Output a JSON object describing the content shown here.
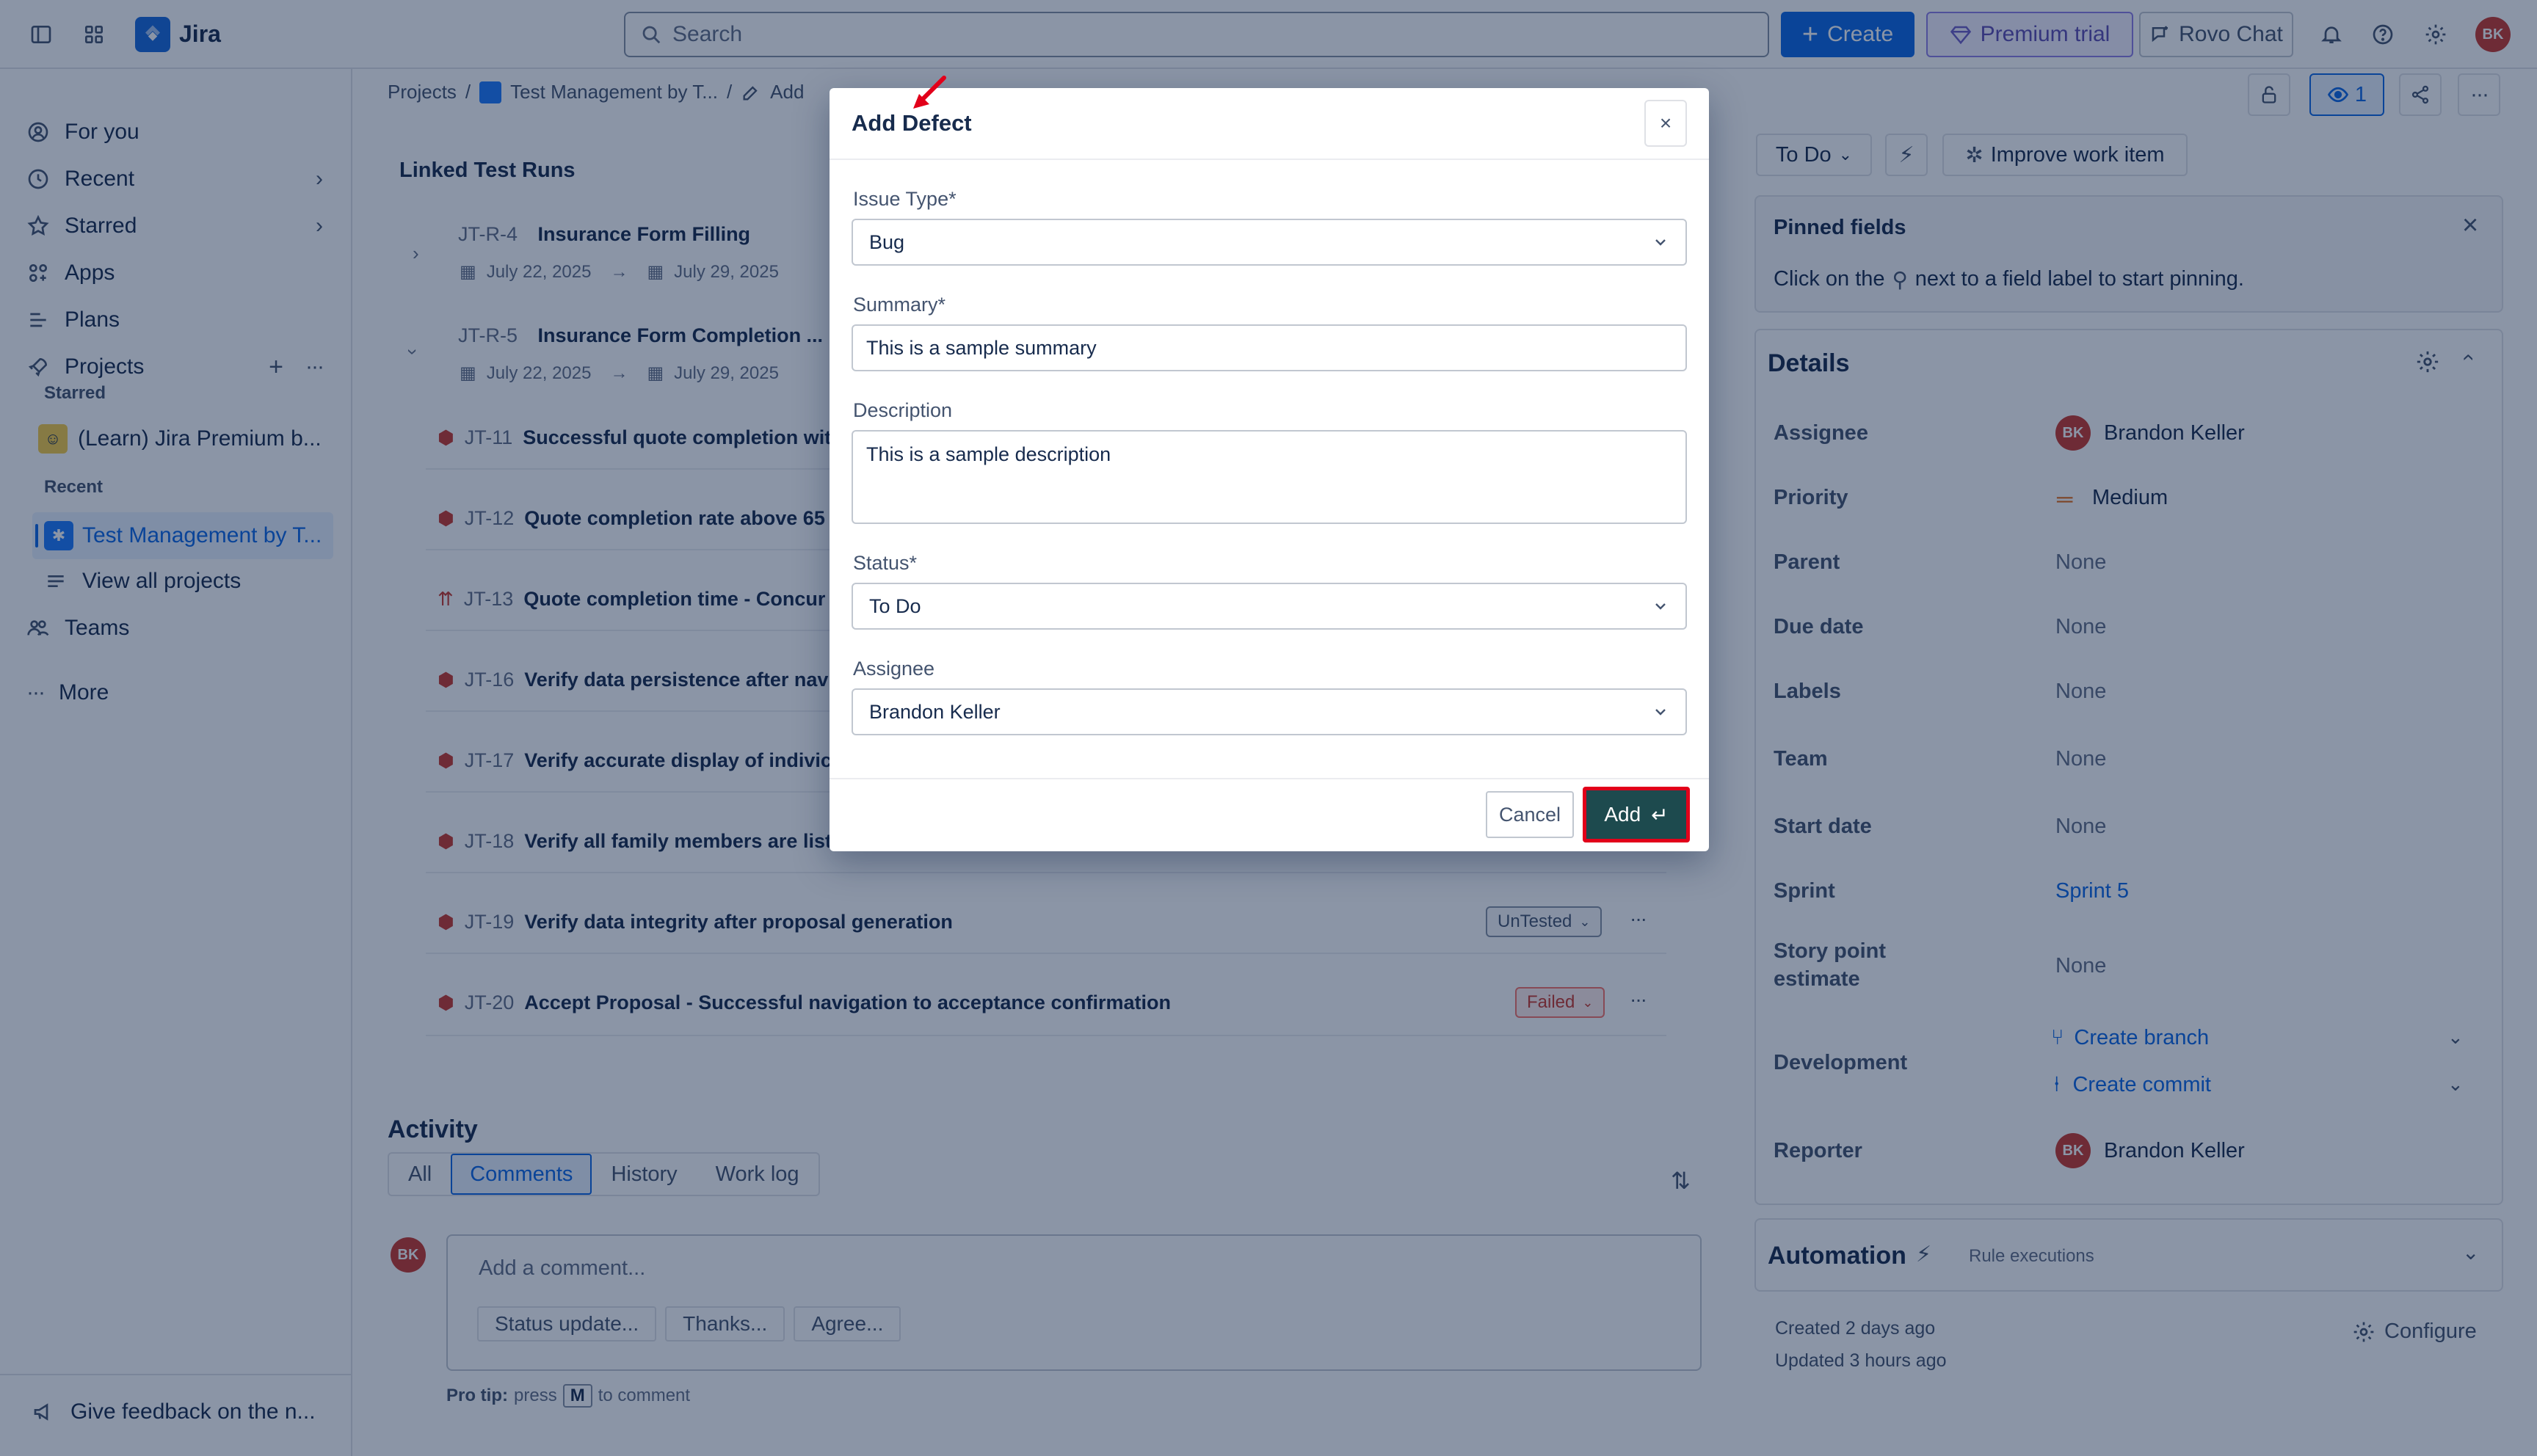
{
  "topbar": {
    "app_name": "Jira",
    "search_placeholder": "Search",
    "create_label": "Create",
    "premium_label": "Premium trial",
    "rovo_label": "Rovo Chat",
    "avatar_initials": "BK"
  },
  "sidebar": {
    "items": {
      "for_you": "For you",
      "recent": "Recent",
      "starred": "Starred",
      "apps": "Apps",
      "plans": "Plans",
      "projects": "Projects",
      "view_all": "View all projects",
      "teams": "Teams",
      "more": "More"
    },
    "starred_heading": "Starred",
    "starred_project": "(Learn) Jira Premium b...",
    "recent_heading": "Recent",
    "recent_project": "Test Management by T...",
    "feedback": "Give feedback on the n..."
  },
  "breadcrumb": {
    "projects": "Projects",
    "sep": "/",
    "project": "Test Management by T...",
    "sep2": "/",
    "partial": "Add"
  },
  "linked": {
    "title": "Linked Test Runs",
    "runs": [
      {
        "key": "JT-R-4",
        "name": "Insurance Form Filling",
        "start": "July 22, 2025",
        "end": "July 29, 2025"
      },
      {
        "key": "JT-R-5",
        "name": "Insurance Form Completion ...",
        "start": "July 22, 2025",
        "end": "July 29, 2025"
      }
    ],
    "cases": [
      {
        "key": "JT-11",
        "name": "Successful quote completion wit"
      },
      {
        "key": "JT-12",
        "name": "Quote completion rate above 65"
      },
      {
        "key": "JT-13",
        "name": "Quote completion time - Concur"
      },
      {
        "key": "JT-16",
        "name": "Verify data persistence after nav"
      },
      {
        "key": "JT-17",
        "name": "Verify accurate display of indivic"
      },
      {
        "key": "JT-18",
        "name": "Verify all family members are list"
      },
      {
        "key": "JT-19",
        "name": "Verify data integrity after proposal generation",
        "status": "UnTested"
      },
      {
        "key": "JT-20",
        "name": "Accept Proposal - Successful navigation to acceptance confirmation",
        "status": "Failed"
      }
    ]
  },
  "activity": {
    "title": "Activity",
    "tabs": [
      "All",
      "Comments",
      "History",
      "Work log"
    ],
    "comment_placeholder": "Add a comment...",
    "quick": [
      "Status update...",
      "Thanks...",
      "Agree..."
    ],
    "pro_tip_bold": "Pro tip:",
    "pro_tip_press": "press",
    "pro_tip_key": "M",
    "pro_tip_rest": "to comment",
    "avatar": "BK"
  },
  "right": {
    "watch_count": "1",
    "status_btn": "To Do",
    "improve": "Improve work item",
    "pinned_title": "Pinned fields",
    "pinned_pre": "Click on the",
    "pinned_post": "next to a field label to start pinning.",
    "details_title": "Details",
    "fields": {
      "assignee_label": "Assignee",
      "assignee_value": "Brandon Keller",
      "assignee_initials": "BK",
      "priority_label": "Priority",
      "priority_value": "Medium",
      "parent_label": "Parent",
      "parent_value": "None",
      "due_label": "Due date",
      "due_value": "None",
      "labels_label": "Labels",
      "labels_value": "None",
      "team_label": "Team",
      "team_value": "None",
      "start_label": "Start date",
      "start_value": "None",
      "sprint_label": "Sprint",
      "sprint_value": "Sprint 5",
      "sp_label_1": "Story point",
      "sp_label_2": "estimate",
      "sp_value": "None",
      "dev_label": "Development",
      "create_branch": "Create branch",
      "create_commit": "Create commit",
      "reporter_label": "Reporter",
      "reporter_value": "Brandon Keller",
      "reporter_initials": "BK"
    },
    "automation_title": "Automation",
    "rule_exec": "Rule executions",
    "created": "Created 2 days ago",
    "updated": "Updated 3 hours ago",
    "configure": "Configure"
  },
  "modal": {
    "title": "Add Defect",
    "close": "×",
    "issue_type_label": "Issue Type*",
    "issue_type_value": "Bug",
    "summary_label": "Summary*",
    "summary_value": "This is a sample summary",
    "description_label": "Description",
    "description_value": "This is a sample description",
    "status_label": "Status*",
    "status_value": "To Do",
    "assignee_label": "Assignee",
    "assignee_value": "Brandon Keller",
    "cancel": "Cancel",
    "add": "Add",
    "add_icon": "↵"
  },
  "colors": {
    "primary": "#0c66e4",
    "premium": "#6e5dc6",
    "danger": "#c9372c",
    "add_button": "#1d4a4e",
    "highlight": "#e2001a"
  }
}
